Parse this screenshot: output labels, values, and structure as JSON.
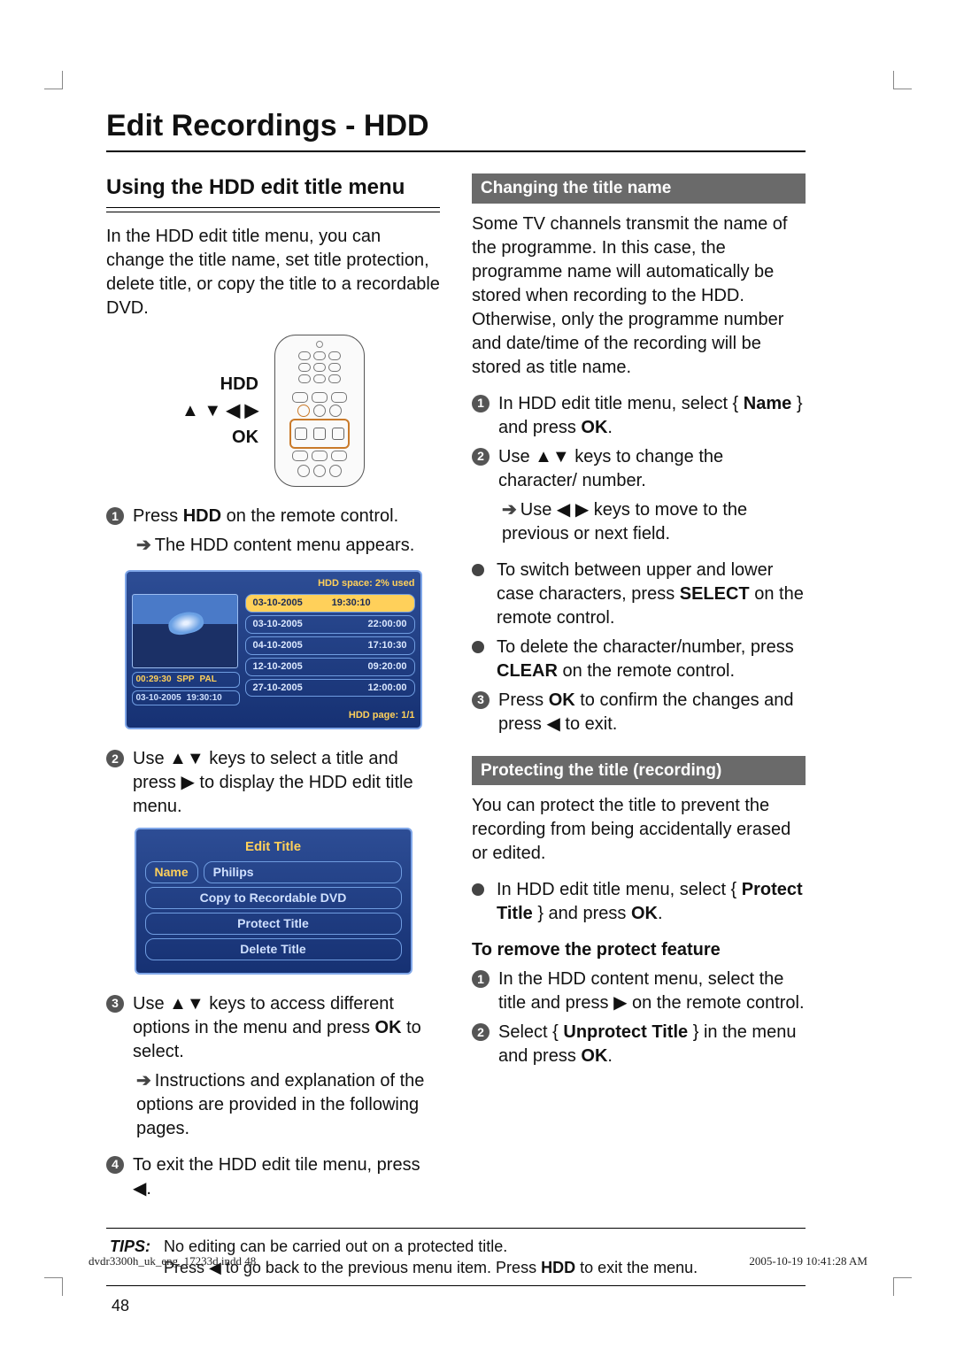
{
  "page": {
    "title": "Edit Recordings - HDD",
    "number": "48"
  },
  "left": {
    "section_title": "Using the HDD edit title menu",
    "intro": "In the HDD edit title menu, you can change the title name, set title protection, delete title, or copy the title to a recordable DVD.",
    "remote_labels": {
      "hdd": "HDD",
      "arrows": "▲ ▼ ◀ ▶",
      "ok": "OK"
    },
    "step1_a": "Press ",
    "step1_b": "HDD",
    "step1_c": " on the remote control.",
    "step1_sub": "The HDD content menu appears.",
    "osd": {
      "space": "HDD space: 2% used",
      "thumb_line1": {
        "dur": "00:29:30",
        "mode": "SPP",
        "std": "PAL"
      },
      "thumb_line2": {
        "date": "03-10-2005",
        "time": "19:30:10"
      },
      "rows": [
        {
          "date": "03-10-2005",
          "time": "19:30:10",
          "selected": true
        },
        {
          "date": "03-10-2005",
          "time": "22:00:00"
        },
        {
          "date": "04-10-2005",
          "time": "17:10:30"
        },
        {
          "date": "12-10-2005",
          "time": "09:20:00"
        },
        {
          "date": "27-10-2005",
          "time": "12:00:00"
        }
      ],
      "page": "HDD page: 1/1"
    },
    "step2": "Use ▲▼ keys to select a title and press ▶ to display the HDD edit title menu.",
    "edit_menu": {
      "title": "Edit Title",
      "name_label": "Name",
      "name_value": "Philips",
      "row_copy": "Copy to Recordable DVD",
      "row_protect": "Protect Title",
      "row_delete": "Delete Title"
    },
    "step3_a": "Use ▲▼ keys to access different options in the menu and press ",
    "step3_b": "OK",
    "step3_c": " to select.",
    "step3_sub": "Instructions and explanation of the options are provided in the following pages.",
    "step4": "To exit the HDD edit tile menu, press ◀."
  },
  "right": {
    "sub1_title": "Changing the title name",
    "sub1_intro": "Some TV channels transmit the name of the programme. In this case, the programme name will automatically be stored when recording to the HDD. Otherwise, only the programme number and date/time of the recording will be stored as title name.",
    "r1_a": "In HDD edit title menu, select { ",
    "r1_b": "Name",
    "r1_c": " } and press ",
    "r1_d": "OK",
    "r1_e": ".",
    "r2": "Use ▲▼ keys to change the character/ number.",
    "r2_sub": "Use ◀ ▶ keys to move to the previous or next field.",
    "rb1_a": "To switch between upper and lower case characters, press ",
    "rb1_b": "SELECT",
    "rb1_c": " on the remote control.",
    "rb2_a": "To delete the character/number, press ",
    "rb2_b": "CLEAR",
    "rb2_c": " on the remote control.",
    "r3_a": "Press ",
    "r3_b": "OK",
    "r3_c": " to confirm the changes and press ◀ to exit.",
    "sub2_title": "Protecting the title (recording)",
    "sub2_intro": "You can protect the title to prevent the recording from being accidentally erased or edited.",
    "p_b1_a": "In HDD edit title menu, select { ",
    "p_b1_b": "Protect Title",
    "p_b1_c": " } and press ",
    "p_b1_d": "OK",
    "p_b1_e": ".",
    "remove_heading": "To remove the protect feature",
    "rm1": "In the HDD content menu, select the title and press ▶ on the remote control.",
    "rm2_a": "Select { ",
    "rm2_b": "Unprotect Title",
    "rm2_c": " } in the menu and press ",
    "rm2_d": "OK",
    "rm2_e": "."
  },
  "tips": {
    "label": "TIPS:",
    "line1": "No editing can be carried out on a protected title.",
    "line2_a": "Press ◀ to go back to the previous menu item. Press ",
    "line2_b": "HDD",
    "line2_c": " to exit the menu."
  },
  "footer": {
    "left": "dvdr3300h_uk_eng_17233d.indd   48",
    "right": "2005-10-19   10:41:28 AM"
  }
}
